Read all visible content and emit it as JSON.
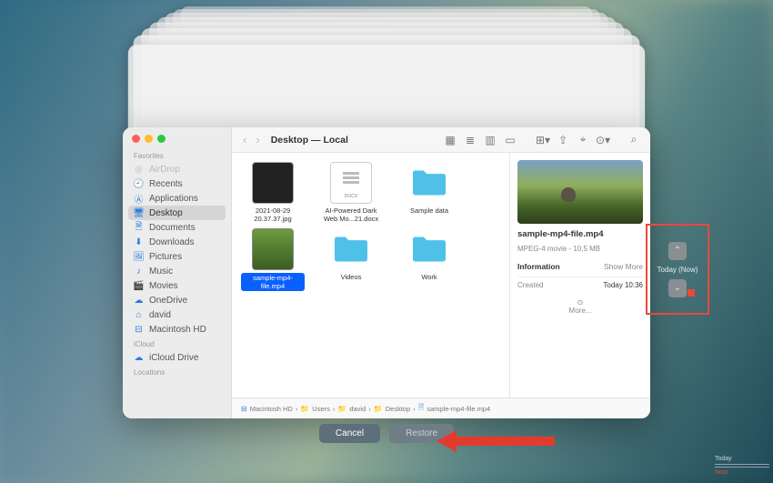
{
  "window": {
    "title": "Desktop — Local"
  },
  "sidebar": {
    "sections": [
      {
        "header": "Favorites",
        "items": [
          {
            "icon": "airdrop",
            "label": "AirDrop",
            "dim": true
          },
          {
            "icon": "recents",
            "label": "Recents"
          },
          {
            "icon": "apps",
            "label": "Applications"
          },
          {
            "icon": "desktop",
            "label": "Desktop",
            "selected": true
          },
          {
            "icon": "docs",
            "label": "Documents"
          },
          {
            "icon": "downloads",
            "label": "Downloads"
          },
          {
            "icon": "pictures",
            "label": "Pictures"
          },
          {
            "icon": "music",
            "label": "Music"
          },
          {
            "icon": "movies",
            "label": "Movies"
          },
          {
            "icon": "onedrive",
            "label": "OneDrive"
          },
          {
            "icon": "home",
            "label": "david"
          },
          {
            "icon": "hd",
            "label": "Macintosh HD"
          }
        ]
      },
      {
        "header": "iCloud",
        "items": [
          {
            "icon": "icloud",
            "label": "iCloud Drive"
          }
        ]
      },
      {
        "header": "Locations",
        "items": []
      }
    ]
  },
  "files": [
    {
      "kind": "jpg",
      "label": "2021-08-29 20.37.37.jpg"
    },
    {
      "kind": "docx",
      "label": "AI-Powered Dark Web Mo...21.docx"
    },
    {
      "kind": "folder",
      "label": "Sample data"
    },
    {
      "kind": "video",
      "label": "sample-mp4-file.mp4",
      "selected": true
    },
    {
      "kind": "folder",
      "label": "Videos"
    },
    {
      "kind": "folder",
      "label": "Work"
    }
  ],
  "preview": {
    "title": "sample-mp4-file.mp4",
    "subtitle": "MPEG-4 movie - 10,5 MB",
    "info_header": "Information",
    "show_more": "Show More",
    "rows": [
      {
        "k": "Created",
        "v": "Today 10:36"
      }
    ],
    "more": "More..."
  },
  "pathbar": [
    "Macintosh HD",
    "Users",
    "david",
    "Desktop",
    "sample-mp4-file.mp4"
  ],
  "buttons": {
    "cancel": "Cancel",
    "restore": "Restore"
  },
  "tm": {
    "label": "Today (Now)"
  },
  "timeline": {
    "today": "Today",
    "now": "Now"
  }
}
